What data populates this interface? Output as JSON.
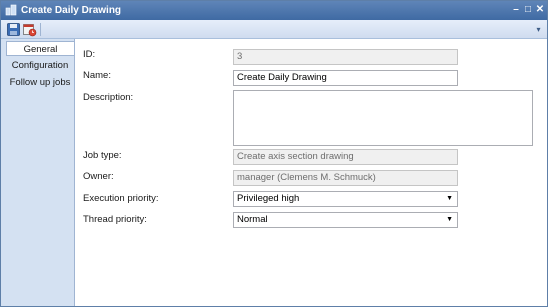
{
  "window": {
    "title": "Create Daily Drawing",
    "controls": {
      "minimize": "–",
      "maximize": "□",
      "close": "✕"
    }
  },
  "toolbar": {
    "save_icon": "save-icon",
    "schedule_icon": "schedule-icon",
    "overflow_glyph": "▾"
  },
  "nav": {
    "items": [
      {
        "label": "General",
        "active": true
      },
      {
        "label": "Configuration",
        "active": false
      },
      {
        "label": "Follow up jobs",
        "active": false
      }
    ]
  },
  "form": {
    "id_label": "ID:",
    "id_value": "3",
    "name_label": "Name:",
    "name_value": "Create Daily Drawing",
    "description_label": "Description:",
    "description_value": "",
    "job_type_label": "Job type:",
    "job_type_value": "Create axis section drawing",
    "owner_label": "Owner:",
    "owner_value": "manager (Clemens M. Schmuck)",
    "execution_priority_label": "Execution priority:",
    "execution_priority_value": "Privileged high",
    "thread_priority_label": "Thread priority:",
    "thread_priority_value": "Normal",
    "dropdown_glyph": "▼"
  },
  "colors": {
    "titlebar": "#4a74ab",
    "nav_background": "#d4e1f2",
    "content_background": "#ffffff"
  }
}
